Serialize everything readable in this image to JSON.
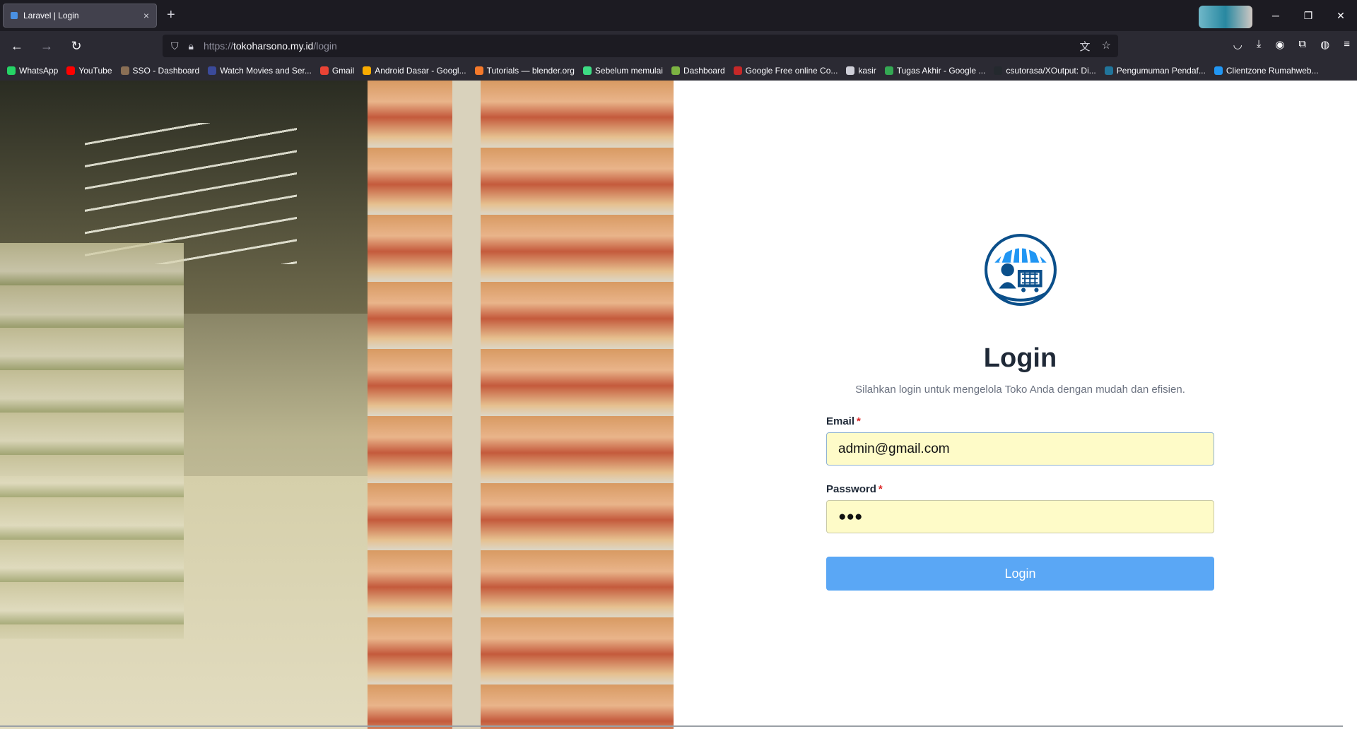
{
  "browser": {
    "tab_title": "Laravel | Login",
    "tab_close": "×",
    "new_tab": "+",
    "url_proto": "https://",
    "url_host": "tokoharsono.my.id",
    "url_path": "/login",
    "controls": {
      "minimize": "─",
      "restore": "❐",
      "close": "✕"
    }
  },
  "bookmarks": [
    {
      "label": "WhatsApp",
      "color": "#25d366"
    },
    {
      "label": "YouTube",
      "color": "#ff0000"
    },
    {
      "label": "SSO - Dashboard",
      "color": "#8a6f55"
    },
    {
      "label": "Watch Movies and Ser...",
      "color": "#3b4a9a"
    },
    {
      "label": "Gmail",
      "color": "#ea4335"
    },
    {
      "label": "Android Dasar - Googl...",
      "color": "#f9ab00"
    },
    {
      "label": "Tutorials — blender.org",
      "color": "#f5792a"
    },
    {
      "label": "Sebelum memulai",
      "color": "#3ddc84"
    },
    {
      "label": "Dashboard",
      "color": "#7cb342"
    },
    {
      "label": "Google Free online Co...",
      "color": "#c62828"
    },
    {
      "label": "kasir",
      "color": "#cfcfd8"
    },
    {
      "label": "Tugas Akhir - Google ...",
      "color": "#34a853"
    },
    {
      "label": "csutorasa/XOutput: Di...",
      "color": "#24292e"
    },
    {
      "label": "Pengumuman Pendaf...",
      "color": "#21759b"
    },
    {
      "label": "Clientzone Rumahweb...",
      "color": "#2196f3"
    }
  ],
  "login": {
    "title": "Login",
    "subtitle": "Silahkan login untuk mengelola Toko Anda dengan mudah dan efisien.",
    "email_label": "Email",
    "email_value": "admin@gmail.com",
    "password_label": "Password",
    "password_value": "●●●",
    "required_mark": "*",
    "button_label": "Login"
  },
  "colors": {
    "button": "#5aa7f5",
    "input_bg": "#fefbc8",
    "required": "#dc2626",
    "logo_primary": "#0b4f8a",
    "logo_accent": "#2196f3"
  }
}
